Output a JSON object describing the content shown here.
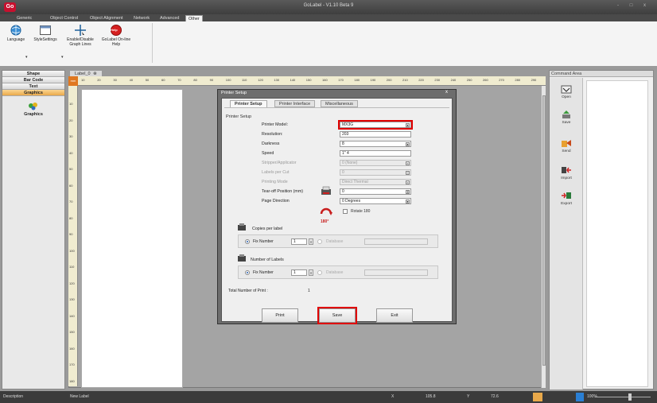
{
  "app": {
    "logo": "Go",
    "title": "GoLabel - V1.10 Beta 9",
    "window_controls": "- □ x"
  },
  "ribbon": {
    "tabs": [
      "Generic",
      "Object Control",
      "Object Alignment",
      "Network",
      "Advanced",
      "Other"
    ],
    "active_tab": "Other",
    "buttons": [
      {
        "label": "Language",
        "icon": "globe-icon"
      },
      {
        "label": "StyleSettings",
        "icon": "window-style-icon"
      },
      {
        "label": "Enable/Disable Graph Lines",
        "icon": "crosshair-icon"
      },
      {
        "label": "GoLabel On-line Help",
        "icon": "help-icon",
        "badge": "Help"
      }
    ]
  },
  "left_panel": {
    "sections": [
      "Shape",
      "Bar Code",
      "Text",
      "Graphics"
    ],
    "active_section": "Graphics",
    "item": {
      "label": "Graphics",
      "icon": "graphics-icon"
    }
  },
  "document": {
    "tab_label": "Label_0",
    "ruler_unit": "mm",
    "ruler_h": [
      "10",
      "20",
      "30",
      "40",
      "50",
      "60",
      "70",
      "80",
      "90",
      "100",
      "110",
      "120",
      "130",
      "140",
      "150",
      "160",
      "170",
      "180",
      "190",
      "200",
      "210",
      "220",
      "230",
      "240",
      "250",
      "260",
      "270",
      "280",
      "290"
    ],
    "ruler_v": [
      "10",
      "20",
      "30",
      "40",
      "50",
      "60",
      "70",
      "80",
      "90",
      "100",
      "110",
      "120",
      "130",
      "140",
      "150",
      "160",
      "170",
      "180"
    ]
  },
  "command_area": {
    "title": "Command Area",
    "buttons": [
      {
        "label": "Open",
        "icon": "open-icon"
      },
      {
        "label": "Save",
        "icon": "save-icon"
      },
      {
        "label": "Send",
        "icon": "send-icon"
      },
      {
        "label": "Import",
        "icon": "import-icon"
      },
      {
        "label": "Export",
        "icon": "export-icon"
      }
    ]
  },
  "dialog": {
    "title": "Printer Setup",
    "close": "x",
    "tabs": [
      "Printer Setup",
      "Printer Interface",
      "Miscellaneous"
    ],
    "active_tab": "Printer Setup",
    "group_label": "Printer Setup",
    "fields": [
      {
        "label": "Printer Model:",
        "value": "MX3G",
        "dropdown": true,
        "enabled": true
      },
      {
        "label": "Resolution:",
        "value": "203",
        "dropdown": false,
        "enabled": true
      },
      {
        "label": "Darkness",
        "value": "8",
        "dropdown": true,
        "enabled": true
      },
      {
        "label": "Speed",
        "value": "1\" 4",
        "dropdown": false,
        "enabled": true
      },
      {
        "label": "Stripper/Applicator",
        "value": "0 (None)",
        "dropdown": true,
        "enabled": false
      },
      {
        "label": "Labels per Cut",
        "value": "0",
        "dropdown": true,
        "enabled": false
      },
      {
        "label": "Printing Mode",
        "value": "Direct Thermal",
        "dropdown": true,
        "enabled": false
      },
      {
        "label": "Tear-off Position (mm)",
        "value": "0",
        "dropdown": true,
        "enabled": true
      },
      {
        "label": "Page Direction",
        "value": "0 Degrees",
        "dropdown": true,
        "enabled": true
      }
    ],
    "rotate": {
      "label": "Rotate 180",
      "badge": "180°"
    },
    "copies": {
      "title": "Copies per label",
      "fix_number": "Fix Number",
      "value": "1",
      "database": "Database"
    },
    "labels": {
      "title": "Number of Labels",
      "fix_number": "Fix Number",
      "value": "1",
      "database": "Database"
    },
    "total": {
      "label": "Total Number of Print :",
      "value": "1"
    },
    "buttons": {
      "print": "Print",
      "save": "Save",
      "exit": "Exit"
    }
  },
  "status": {
    "description_label": "Description",
    "description_value": "New Label",
    "x_label": "X",
    "x_value": "105.8",
    "y_label": "Y",
    "y_value": "72.6",
    "zoom": "100%"
  },
  "colors": {
    "highlight": "#e00000",
    "active_section": "#e9a94a",
    "ruler_origin": "#e07820"
  }
}
